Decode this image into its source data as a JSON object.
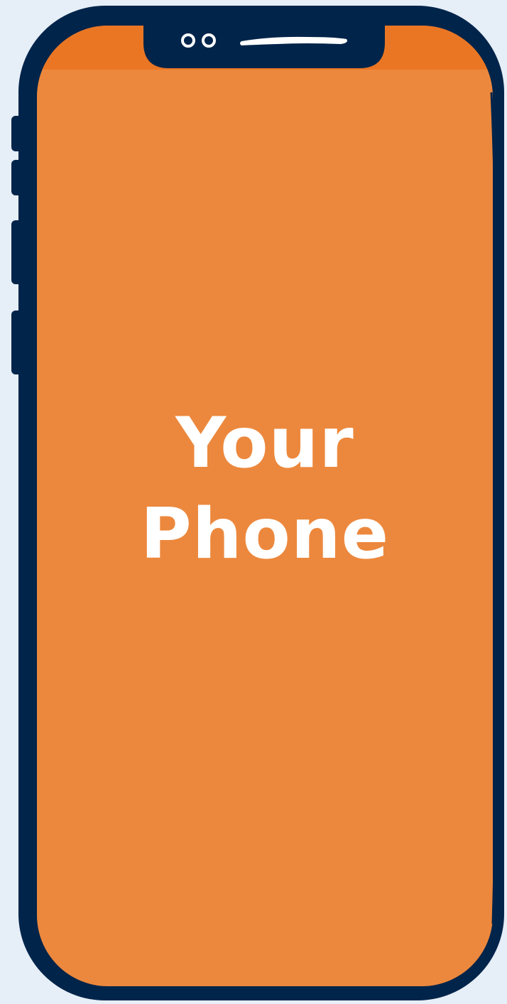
{
  "screen": {
    "line1": "Your",
    "line2": "Phone"
  },
  "colors": {
    "background": "#e6eef7",
    "frame": "#01244a",
    "screen": "#ec883d",
    "screen_top_band": "#ea7624",
    "text": "#ffffff"
  },
  "icons": {
    "camera_dots": "camera-icon",
    "speaker_slot": "speaker-icon"
  }
}
